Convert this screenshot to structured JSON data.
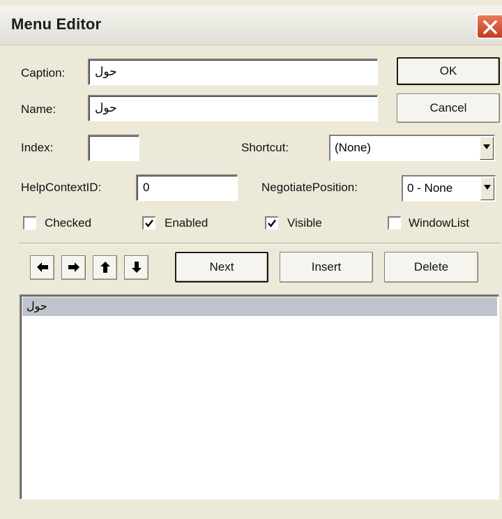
{
  "window": {
    "title": "Menu Editor"
  },
  "fields": {
    "caption": {
      "label": "Caption:",
      "value": "حول"
    },
    "name": {
      "label": "Name:",
      "value": "حول"
    },
    "index": {
      "label": "Index:",
      "value": ""
    },
    "shortcut": {
      "label": "Shortcut:",
      "value": "(None)"
    },
    "helpcontextid": {
      "label": "HelpContextID:",
      "value": "0"
    },
    "negotiateposition": {
      "label": "NegotiatePosition:",
      "value": "0 - None"
    }
  },
  "checkboxes": {
    "checked": {
      "label": "Checked",
      "checked": false
    },
    "enabled": {
      "label": "Enabled",
      "checked": true
    },
    "visible": {
      "label": "Visible",
      "checked": true
    },
    "windowlist": {
      "label": "WindowList",
      "checked": false
    }
  },
  "buttons": {
    "ok": "OK",
    "cancel": "Cancel",
    "next": "Next",
    "insert": "Insert",
    "delete": "Delete"
  },
  "arrows": [
    "arrow-left-icon",
    "arrow-right-icon",
    "arrow-up-icon",
    "arrow-down-icon"
  ],
  "menu_list": {
    "items": [
      "حول"
    ],
    "selected_index": 0
  },
  "colors": {
    "close_button": "#c23e21",
    "list_selection": "#c0c3cb",
    "dialog_background": "#ece9d8"
  }
}
